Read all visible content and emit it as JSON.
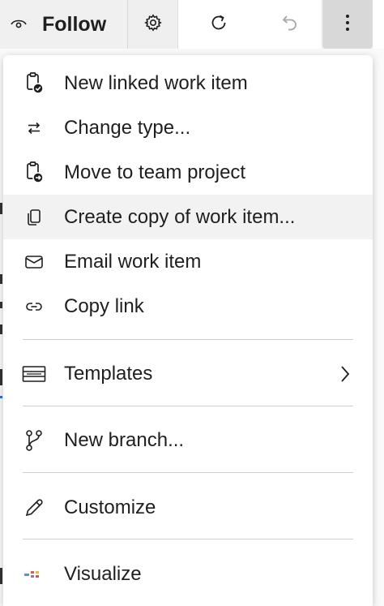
{
  "toolbar": {
    "follow_label": "Follow",
    "follow_icon": "eye-icon",
    "settings_icon": "gear-icon",
    "refresh_icon": "refresh-icon",
    "undo_icon": "undo-icon",
    "more_icon": "more-vertical-icon"
  },
  "menu": {
    "items": [
      {
        "label": "New linked work item",
        "icon": "linked-work-item-icon"
      },
      {
        "label": "Change type...",
        "icon": "swap-arrows-icon"
      },
      {
        "label": "Move to team project",
        "icon": "move-clipboard-icon"
      },
      {
        "label": "Create copy of work item...",
        "icon": "copy-icon",
        "highlighted": true
      },
      {
        "label": "Email work item",
        "icon": "mail-icon"
      },
      {
        "label": "Copy link",
        "icon": "link-icon"
      },
      {
        "label": "Templates",
        "icon": "templates-icon",
        "submenu": true
      },
      {
        "label": "New branch...",
        "icon": "branch-icon"
      },
      {
        "label": "Customize",
        "icon": "pencil-icon"
      },
      {
        "label": "Visualize",
        "icon": "visualize-icon"
      }
    ]
  },
  "colors": {
    "text": "#1f1f1f",
    "highlight": "#f2f2f2",
    "divider": "#cfcfcf",
    "more_button_active": "#d8d8d8"
  }
}
